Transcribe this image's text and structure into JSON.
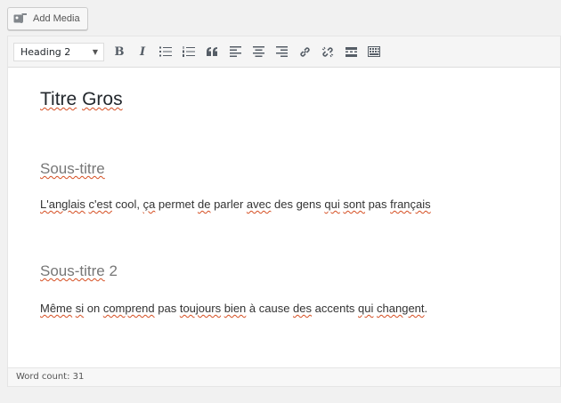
{
  "media": {
    "add_media_label": "Add Media"
  },
  "toolbar": {
    "format_value": "Heading 2",
    "bold_label": "B",
    "italic_label": "I"
  },
  "content": {
    "title": [
      "Titre",
      "Gros"
    ],
    "subtitle1": "Sous-titre",
    "para1": {
      "w_anglais": "L'anglais",
      "w_cest": "c'est",
      "t1": " cool, ",
      "w_ca": "ça",
      "t2": " permet ",
      "w_de": "de",
      "t3": " parler ",
      "w_avec": "avec",
      "t4": " des gens ",
      "w_qui": "qui",
      "t5": " ",
      "w_sont": "sont",
      "t6": " pas ",
      "w_francais": "français"
    },
    "subtitle2": {
      "w": "Sous-titre",
      "rest": " 2"
    },
    "para2": {
      "w_meme": "Même",
      "t0": " ",
      "w_si": "si",
      "t1": " on ",
      "w_comprend": "comprend",
      "t2": " pas ",
      "w_toujours": "toujours",
      "t3": " ",
      "w_bien": "bien",
      "t4": " à cause ",
      "w_des": "des",
      "t5": " accents ",
      "w_qui": "qui",
      "t6": " ",
      "w_changent": "changent",
      "t7": "."
    }
  },
  "status": {
    "word_count": "Word count: 31"
  },
  "colors": {
    "spellcheck": "#d54e21",
    "subtitle": "#777777",
    "toolbar_bg": "#f5f5f5"
  }
}
